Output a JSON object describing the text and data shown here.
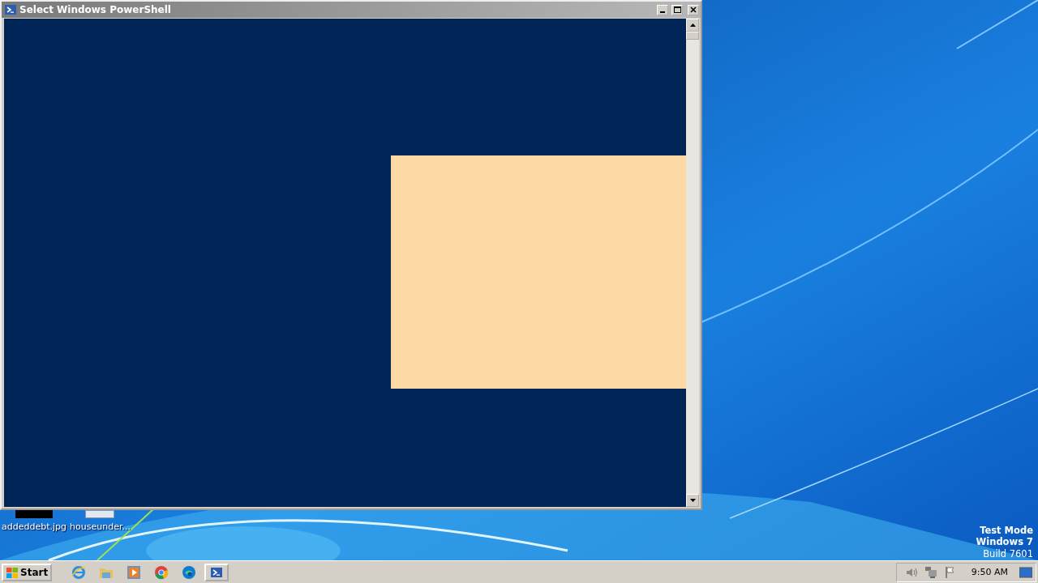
{
  "window": {
    "title": "Select Windows PowerShell"
  },
  "desktop_icons": [
    {
      "label": "addeddebt.jpg",
      "kind": "dark"
    },
    {
      "label": "houseunder...",
      "kind": "light"
    }
  ],
  "system_notice": [
    "Test Mode",
    "Windows 7",
    "Build 7601"
  ],
  "taskbar": {
    "start": "Start",
    "pinned": [
      {
        "kind": "ie",
        "selected": false
      },
      {
        "kind": "folder",
        "selected": false
      },
      {
        "kind": "media",
        "selected": false
      },
      {
        "kind": "chrome",
        "selected": false
      },
      {
        "kind": "edge",
        "selected": false
      },
      {
        "kind": "powershell",
        "selected": true
      }
    ],
    "clock": "9:50 AM"
  }
}
